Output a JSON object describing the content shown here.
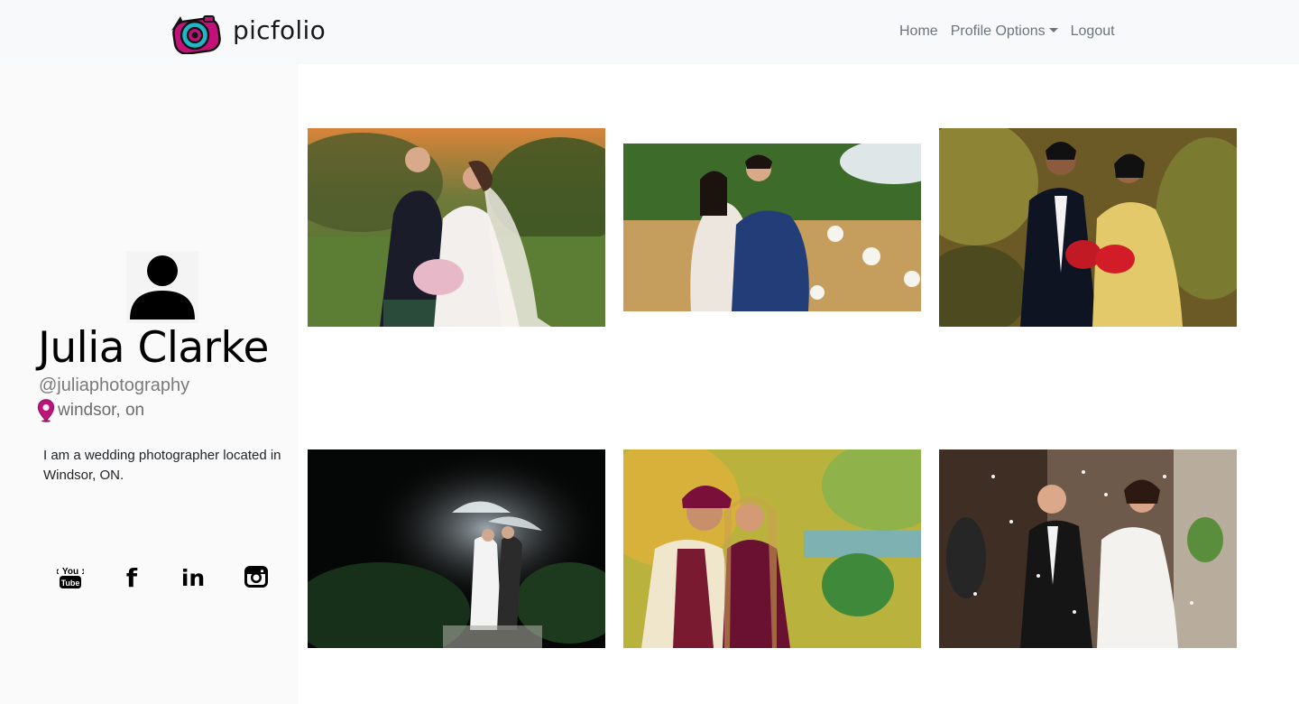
{
  "navbar": {
    "brand": "picfolio",
    "links": {
      "home": "Home",
      "profile_options": "Profile Options",
      "logout": "Logout"
    }
  },
  "profile": {
    "avatar_icon": "user-silhouette-icon",
    "name": "Julia Clarke",
    "handle": "@juliaphotography",
    "location": "windsor, on",
    "bio": "I am a wedding photographer located in Windsor, ON.",
    "social": [
      {
        "name": "youtube-icon",
        "label": "You Tube"
      },
      {
        "name": "facebook-icon",
        "label": "f"
      },
      {
        "name": "linkedin-icon",
        "label": "in"
      },
      {
        "name": "instagram-icon"
      }
    ]
  },
  "gallery": {
    "photos": [
      {
        "subject": "wedding couple in kilt on lawn at sunset"
      },
      {
        "subject": "couple embracing in wildflower field"
      },
      {
        "subject": "couple with red bouquet among autumn leaves"
      },
      {
        "subject": "couple under clear umbrella at night in rain"
      },
      {
        "subject": "couple in traditional red and maroon attire"
      },
      {
        "subject": "couple walking through confetti toss"
      }
    ]
  },
  "colors": {
    "navbar_bg": "#f8f9fa",
    "sidebar_bg": "#fafafa",
    "logo_magenta": "#c2127a",
    "logo_teal": "#22b5c5",
    "pin_purple": "#8e1a6a",
    "nav_text": "#6c757d"
  }
}
